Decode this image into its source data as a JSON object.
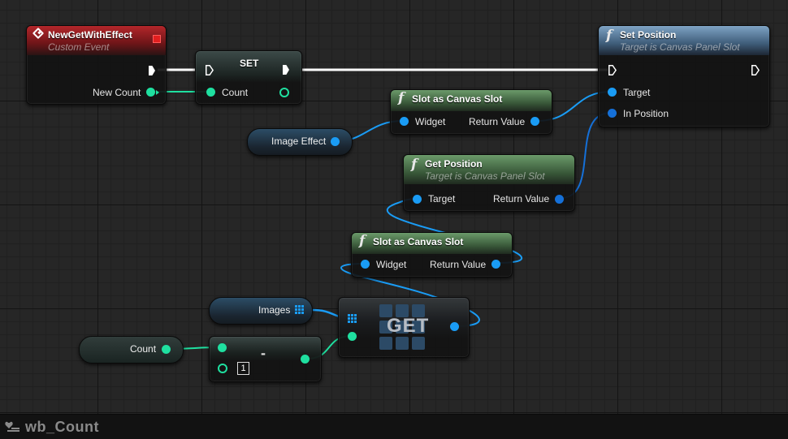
{
  "blueprint": {
    "name": "wb_Count"
  },
  "nodes": {
    "event": {
      "title": "NewGetWithEffect",
      "subtitle": "Custom Event",
      "out_pin": "New Count"
    },
    "set": {
      "title": "SET",
      "in_pin": "Count"
    },
    "set_position": {
      "title": "Set Position",
      "subtitle": "Target is Canvas Panel Slot",
      "pin_target": "Target",
      "pin_in_position": "In Position"
    },
    "slot_canvas_1": {
      "title": "Slot as Canvas Slot",
      "pin_widget": "Widget",
      "pin_return": "Return Value"
    },
    "image_effect": {
      "label": "Image Effect"
    },
    "get_position": {
      "title": "Get Position",
      "subtitle": "Target is Canvas Panel Slot",
      "pin_target": "Target",
      "pin_return": "Return Value"
    },
    "slot_canvas_2": {
      "title": "Slot as Canvas Slot",
      "pin_widget": "Widget",
      "pin_return": "Return Value"
    },
    "images": {
      "label": "Images"
    },
    "count_var": {
      "label": "Count"
    },
    "subtract": {
      "symbol": "-",
      "literal": "1"
    },
    "get": {
      "title": "GET"
    }
  },
  "colors": {
    "exec": "#ffffff",
    "integer": "#1fe0a0",
    "object": "#1a9cf5",
    "struct": "#1570d8",
    "event_header": "#b3262a",
    "function_header": "#6b9a6a",
    "target_header": "#7ea3c4"
  },
  "icons": {
    "event": "custom-event-diamond-icon",
    "function": "function-f-icon",
    "array": "array-grid-icon",
    "blueprint": "widget-blueprint-icon"
  }
}
